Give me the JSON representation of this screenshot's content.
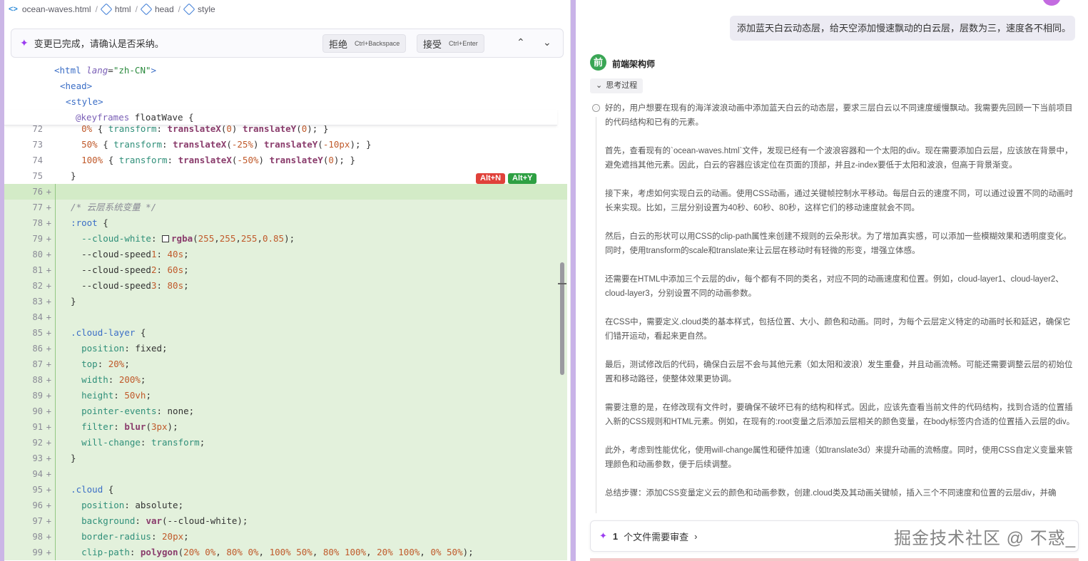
{
  "breadcrumb": {
    "items": [
      "ocean-waves.html",
      "html",
      "head",
      "style"
    ]
  },
  "review_bar": {
    "message": "变更已完成，请确认是否采纳。",
    "reject_label": "拒绝",
    "reject_shortcut": "Ctrl+Backspace",
    "accept_label": "接受",
    "accept_shortcut": "Ctrl+Enter"
  },
  "sticky_lines": [
    "<html lang=\"zh-CN\">",
    "<head>",
    "<style>",
    "@keyframes floatWave {"
  ],
  "badges": {
    "reject": "Alt+N",
    "accept": "Alt+Y"
  },
  "code_lines": [
    {
      "num": "72",
      "text": "    0% { transform: translateX(0) translateY(0); }",
      "added": false
    },
    {
      "num": "73",
      "text": "    50% { transform: translateX(-25%) translateY(-10px); }",
      "added": false
    },
    {
      "num": "74",
      "text": "    100% { transform: translateX(-50%) translateY(0); }",
      "added": false
    },
    {
      "num": "75",
      "text": "  }",
      "added": false
    },
    {
      "num": "76",
      "text": "",
      "added": true
    },
    {
      "num": "77",
      "text": "  /* 云层系统变量 */",
      "added": true
    },
    {
      "num": "78",
      "text": "  :root {",
      "added": true
    },
    {
      "num": "79",
      "text": "    --cloud-white: rgba(255,255,255,0.85);",
      "added": true
    },
    {
      "num": "80",
      "text": "    --cloud-speed1: 40s;",
      "added": true
    },
    {
      "num": "81",
      "text": "    --cloud-speed2: 60s;",
      "added": true
    },
    {
      "num": "82",
      "text": "    --cloud-speed3: 80s;",
      "added": true
    },
    {
      "num": "83",
      "text": "  }",
      "added": true
    },
    {
      "num": "84",
      "text": "",
      "added": true
    },
    {
      "num": "85",
      "text": "  .cloud-layer {",
      "added": true
    },
    {
      "num": "86",
      "text": "    position: fixed;",
      "added": true
    },
    {
      "num": "87",
      "text": "    top: 20%;",
      "added": true
    },
    {
      "num": "88",
      "text": "    width: 200%;",
      "added": true
    },
    {
      "num": "89",
      "text": "    height: 50vh;",
      "added": true
    },
    {
      "num": "90",
      "text": "    pointer-events: none;",
      "added": true
    },
    {
      "num": "91",
      "text": "    filter: blur(3px);",
      "added": true
    },
    {
      "num": "92",
      "text": "    will-change: transform;",
      "added": true
    },
    {
      "num": "93",
      "text": "  }",
      "added": true
    },
    {
      "num": "94",
      "text": "",
      "added": true
    },
    {
      "num": "95",
      "text": "  .cloud {",
      "added": true
    },
    {
      "num": "96",
      "text": "    position: absolute;",
      "added": true
    },
    {
      "num": "97",
      "text": "    background: var(--cloud-white);",
      "added": true
    },
    {
      "num": "98",
      "text": "    border-radius: 20px;",
      "added": true
    },
    {
      "num": "99",
      "text": "    clip-path: polygon(20% 0%, 80% 0%, 100% 50%, 80% 100%, 20% 100%, 0% 50%);",
      "added": true
    }
  ],
  "chat": {
    "user_message": "添加蓝天白云动态层，给天空添加慢速飘动的白云层，层数为三，速度各不相同。",
    "agent_avatar": "前",
    "agent_name": "前端架构师",
    "think_toggle": "思考过程",
    "think_paragraphs": [
      "好的，用户想要在现有的海洋波浪动画中添加蓝天白云的动态层，要求三层白云以不同速度缓慢飘动。我需要先回顾一下当前项目的代码结构和已有的元素。",
      "首先，查看现有的`ocean-waves.html`文件，发现已经有一个波浪容器和一个太阳的div。现在需要添加白云层，应该放在背景中，避免遮挡其他元素。因此，白云的容器应该定位在页面的顶部，并且z-index要低于太阳和波浪，但高于背景渐变。",
      "接下来，考虑如何实现白云的动画。使用CSS动画，通过关键帧控制水平移动。每层白云的速度不同，可以通过设置不同的动画时长来实现。比如，三层分别设置为40秒、60秒、80秒，这样它们的移动速度就会不同。",
      "然后，白云的形状可以用CSS的clip-path属性来创建不规则的云朵形状。为了增加真实感，可以添加一些模糊效果和透明度变化。同时，使用transform的scale和translate来让云层在移动时有轻微的形变，增强立体感。",
      "还需要在HTML中添加三个云层的div，每个都有不同的类名，对应不同的动画速度和位置。例如，cloud-layer1、cloud-layer2、cloud-layer3，分别设置不同的动画参数。",
      "在CSS中，需要定义.cloud类的基本样式，包括位置、大小、颜色和动画。同时，为每个云层定义特定的动画时长和延迟，确保它们错开运动，看起来更自然。",
      "最后，测试修改后的代码，确保白云层不会与其他元素（如太阳和波浪）发生重叠，并且动画流畅。可能还需要调整云层的初始位置和移动路径，使整体效果更协调。",
      "需要注意的是，在修改现有文件时，要确保不破坏已有的结构和样式。因此，应该先查看当前文件的代码结构，找到合适的位置插入新的CSS规则和HTML元素。例如，在现有的:root变量之后添加云层相关的颜色变量，在body标签内合适的位置插入云层的div。",
      "此外，考虑到性能优化，使用will-change属性和硬件加速（如translate3d）来提升动画的流畅度。同时，使用CSS自定义变量来管理颜色和动画参数，便于后续调整。",
      "总结步骤：添加CSS变量定义云的颜色和动画参数，创建.cloud类及其动画关键帧，插入三个不同速度和位置的云层div，并确"
    ],
    "review_count": "1",
    "review_label": "个文件需要审查",
    "watermark": "掘金技术社区 @ 不惑_"
  }
}
